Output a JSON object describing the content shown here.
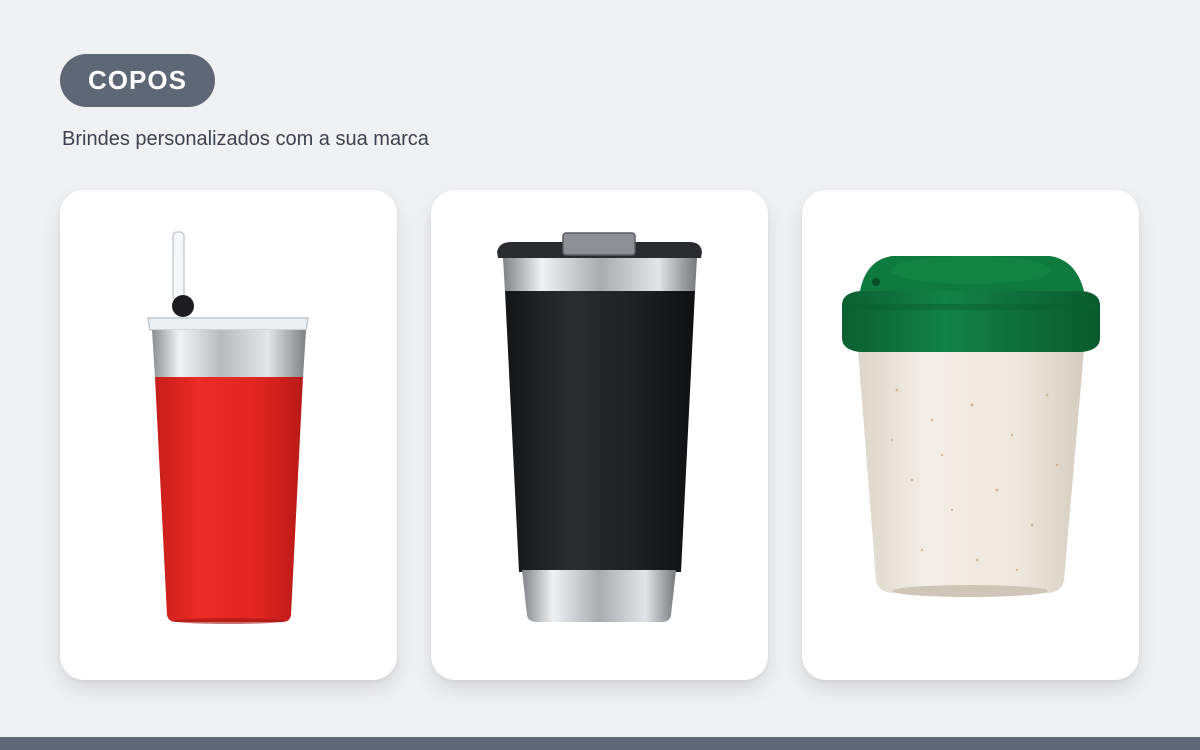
{
  "header": {
    "badge_label": "COPOS",
    "subtitle": "Brindes personalizados com a sua marca"
  },
  "products": [
    {
      "icon": "red-tumbler-with-straw-image",
      "body_color": "#e52420",
      "lid_color": "#e8ecef"
    },
    {
      "icon": "black-thermal-cup-image",
      "body_color": "#1f2022",
      "lid_color": "#2a2b2e"
    },
    {
      "icon": "eco-cup-green-lid-image",
      "body_color": "#efe9e0",
      "lid_color": "#0f7a3e"
    }
  ],
  "colors": {
    "page_background": "#f0f1f3",
    "badge_background": "#5e6775",
    "footer_bar": "#5e6775",
    "card_background": "#ffffff"
  }
}
